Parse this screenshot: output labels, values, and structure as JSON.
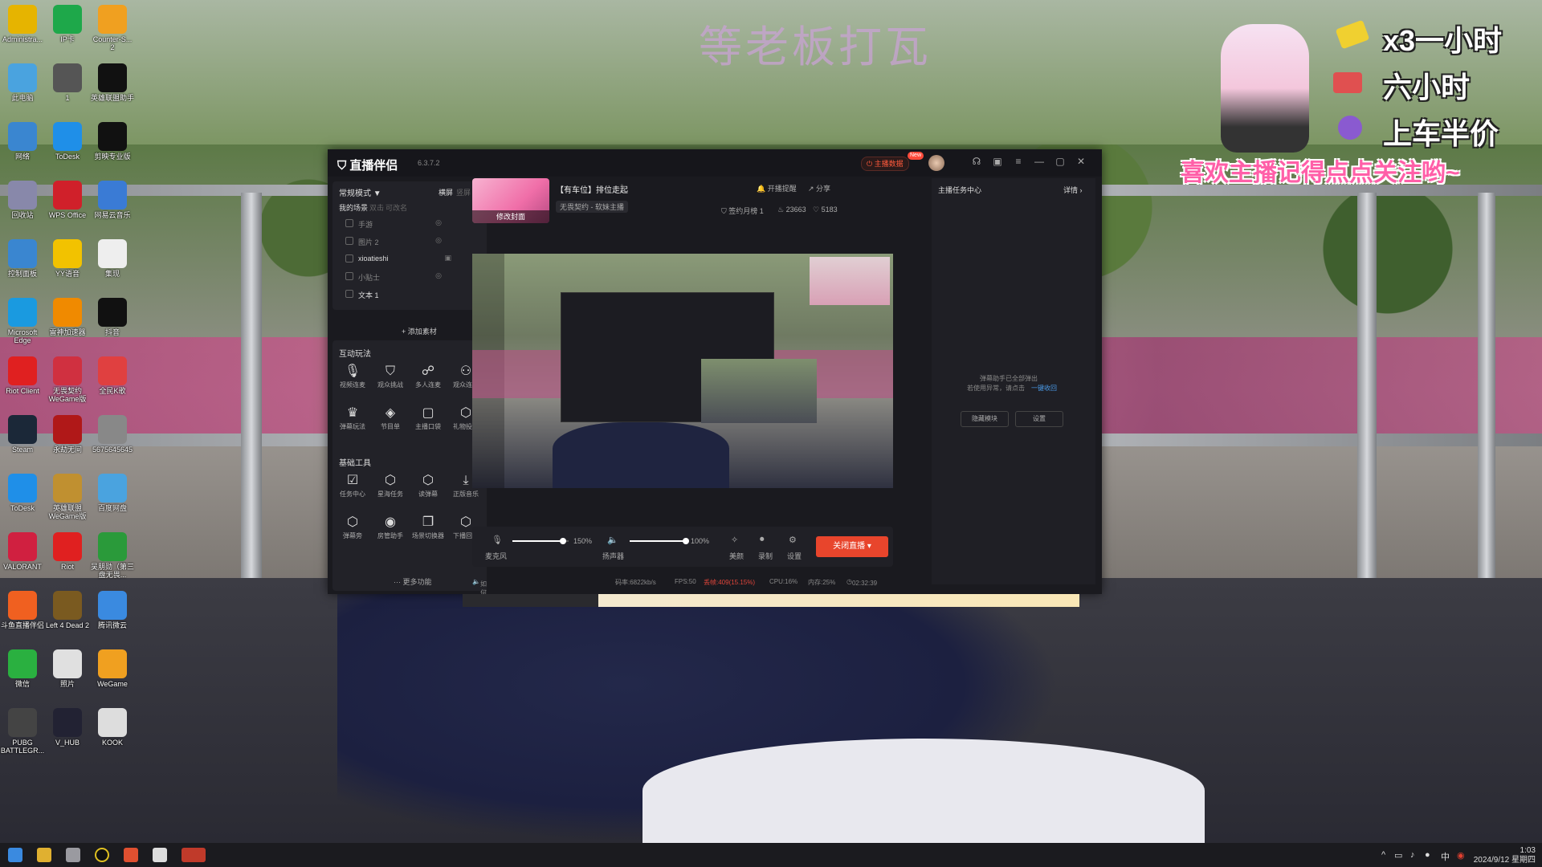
{
  "overlay": {
    "title": "等老板打瓦",
    "promo_lines": [
      "x3一小时",
      "六小时",
      "上车半价"
    ],
    "promo_pink": "喜欢主播记得点点关注哟~"
  },
  "desktop_icons": [
    {
      "label": "Administra...",
      "color": "#e6b400"
    },
    {
      "label": "IP卡",
      "color": "#1ea84a"
    },
    {
      "label": "Counter-S... 2",
      "color": "#f0a020"
    },
    {
      "label": "此电脑",
      "color": "#4aa3df"
    },
    {
      "label": "1",
      "color": "#555"
    },
    {
      "label": "英雄联盟助手",
      "color": "#111"
    },
    {
      "label": "网络",
      "color": "#3a86d0"
    },
    {
      "label": "ToDesk",
      "color": "#1f8fe8"
    },
    {
      "label": "剪映专业版",
      "color": "#111"
    },
    {
      "label": "回收站",
      "color": "#88a"
    },
    {
      "label": "WPS Office",
      "color": "#d0202a"
    },
    {
      "label": "网易云音乐",
      "color": "#3a7bd5"
    },
    {
      "label": "控制面板",
      "color": "#3a86d0"
    },
    {
      "label": "YY语音",
      "color": "#f2c200"
    },
    {
      "label": "集现",
      "color": "#eee"
    },
    {
      "label": "Microsoft Edge",
      "color": "#1a9ae0"
    },
    {
      "label": "雷神加速器",
      "color": "#f08a00"
    },
    {
      "label": "抖音",
      "color": "#111"
    },
    {
      "label": "Riot Client",
      "color": "#e02020"
    },
    {
      "label": "无畏契约 WeGame版",
      "color": "#d03040"
    },
    {
      "label": "全民K歌",
      "color": "#e04040"
    },
    {
      "label": "Steam",
      "color": "#1b2838"
    },
    {
      "label": "永劫无间",
      "color": "#b01818"
    },
    {
      "label": "5675645645",
      "color": "#888"
    },
    {
      "label": "ToDesk",
      "color": "#1f8fe8"
    },
    {
      "label": "英雄联盟 WeGame版",
      "color": "#c09030"
    },
    {
      "label": "百度网盘",
      "color": "#4aa3df"
    },
    {
      "label": "VALORANT",
      "color": "#d02040"
    },
    {
      "label": "Riot",
      "color": "#e02020"
    },
    {
      "label": "吴朋勋（第三盘无畏...",
      "color": "#2a9a3a"
    },
    {
      "label": "斗鱼直播伴侣",
      "color": "#f06020"
    },
    {
      "label": "Left 4 Dead 2",
      "color": "#7a5a20"
    },
    {
      "label": "腾讯微云",
      "color": "#3a8ae0"
    },
    {
      "label": "微信",
      "color": "#2ab040"
    },
    {
      "label": "照片",
      "color": "#e0e0e0"
    },
    {
      "label": "WeGame",
      "color": "#f0a020"
    },
    {
      "label": "PUBG BATTLEGR...",
      "color": "#444"
    },
    {
      "label": "V_HUB",
      "color": "#223"
    },
    {
      "label": "KOOK",
      "color": "#ddd"
    }
  ],
  "app": {
    "name": "直播伴侣",
    "version": "6.3.7.2",
    "streamer_data_label": "主播数据",
    "new_badge": "New",
    "mode": "常规模式 ▼",
    "orient_h": "横屏",
    "orient_v": "竖屏",
    "scene_tabs": [
      "我的场景",
      "双击",
      "可改名"
    ],
    "scenes": [
      {
        "name": "手游",
        "enabled": false
      },
      {
        "name": "图片 2",
        "enabled": false
      },
      {
        "name": "xioatieshi",
        "enabled": true
      },
      {
        "name": "小贴士",
        "enabled": false
      },
      {
        "name": "文本 1",
        "enabled": true
      }
    ],
    "add_material": "+ 添加素材",
    "interactive_title": "互动玩法",
    "interactive": [
      {
        "icon": "🎙",
        "label": "视频连麦"
      },
      {
        "icon": "⛉",
        "label": "观众挑战"
      },
      {
        "icon": "☍",
        "label": "多人连麦"
      },
      {
        "icon": "⚇",
        "label": "观众连麦"
      },
      {
        "icon": "♛",
        "label": "弹幕玩法"
      },
      {
        "icon": "◈",
        "label": "节目单"
      },
      {
        "icon": "▢",
        "label": "主播口袋"
      },
      {
        "icon": "⬡",
        "label": "礼物投票"
      }
    ],
    "tools_title": "基础工具",
    "tools": [
      {
        "icon": "☑",
        "label": "任务中心"
      },
      {
        "icon": "⬡",
        "label": "星海任务"
      },
      {
        "icon": "⬡",
        "label": "读弹幕"
      },
      {
        "icon": "⤓",
        "label": "正版音乐"
      },
      {
        "icon": "⬡",
        "label": "弹幕旁"
      },
      {
        "icon": "◉",
        "label": "房管助手"
      },
      {
        "icon": "❐",
        "label": "场景切换器"
      },
      {
        "icon": "⬡",
        "label": "下播回顾"
      }
    ],
    "more": "··· 更多功能",
    "cover_label": "修改封面",
    "stream_title": "【有车位】排位走起",
    "category": "无畏契约 - 软妹主播",
    "live_remind": "开播提醒",
    "share": "分享",
    "signed": "签约月榜 1",
    "hot": "23663",
    "likes": "5183",
    "mic_label": "麦克风",
    "mic_value": "150%",
    "mic_level": 0.9,
    "speaker_label": "扬声器",
    "speaker_value": "100%",
    "speaker_level": 1.0,
    "beauty": "美颜",
    "record": "录制",
    "settings": "设置",
    "close_live": "关闭直播",
    "status": {
      "help": "如何快速上手直播伴侣?",
      "bitrate": "码率:6822kb/s",
      "fps": "FPS:50",
      "dropped": "丢帧:409(15.15%)",
      "cpu": "CPU:16%",
      "mem": "内存:25%",
      "time": "02:32:39"
    },
    "right_title": "主播任务中心",
    "right_details": "详情 ›",
    "right_msg1": "弹幕助手已全部弹出",
    "right_msg2": "若使用异常，请点击",
    "right_link": "一键收回",
    "hide_module": "隐藏模块",
    "right_settings": "设置"
  },
  "taskbar": {
    "time": "1:03",
    "date": "2024/9/12 星期四",
    "ime": "中"
  }
}
